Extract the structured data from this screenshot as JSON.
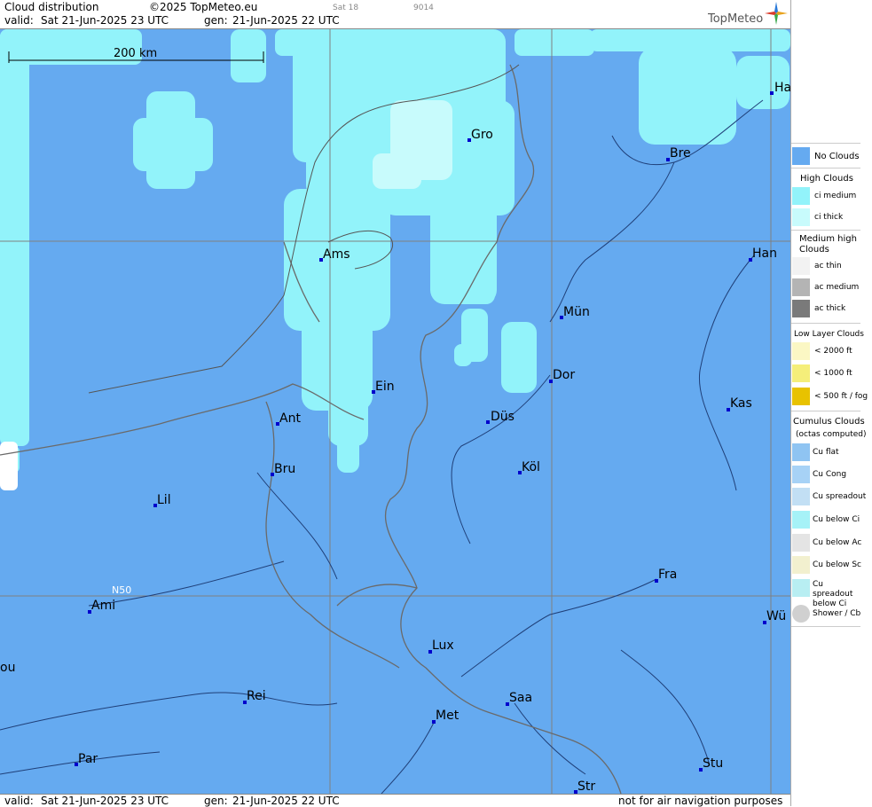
{
  "header": {
    "title": "Cloud distribution",
    "copyright": "©2025 TopMeteo.eu",
    "valid_label": "valid:",
    "valid_value": "Sat  21-Jun-2025  23 UTC",
    "gen_label": "gen:",
    "gen_value": "21-Jun-2025 22 UTC",
    "sat_text": "Sat 18",
    "code_text": "9014",
    "brand": "TopMeteo"
  },
  "footer": {
    "valid_label": "valid:",
    "valid_value": "Sat  21-Jun-2025  23 UTC",
    "gen_label": "gen:",
    "gen_value": "21-Jun-2025 22 UTC",
    "disclaimer": "not for air navigation purposes"
  },
  "map": {
    "scale_label": "200 km",
    "lat_label": "N50",
    "colors": {
      "no_clouds": "#65aaf0",
      "ci_medium": "#92f3fa",
      "ci_thick": "#c8fbfc",
      "border": "#6a6a6a",
      "river": "#1f3f78",
      "grid": "#808080"
    },
    "cities": [
      {
        "name": "Ha"
      },
      {
        "name": "Gro"
      },
      {
        "name": "Bre"
      },
      {
        "name": "Ams"
      },
      {
        "name": "Han"
      },
      {
        "name": "Mün"
      },
      {
        "name": "Dor"
      },
      {
        "name": "Ein"
      },
      {
        "name": "Kas"
      },
      {
        "name": "Ant"
      },
      {
        "name": "Düs"
      },
      {
        "name": "Köl"
      },
      {
        "name": "Bru"
      },
      {
        "name": "Lil"
      },
      {
        "name": "Fra"
      },
      {
        "name": "Ami"
      },
      {
        "name": "Wü"
      },
      {
        "name": "Lux"
      },
      {
        "name": "ou"
      },
      {
        "name": "Rei"
      },
      {
        "name": "Saa"
      },
      {
        "name": "Met"
      },
      {
        "name": "Par"
      },
      {
        "name": "Stu"
      },
      {
        "name": "Str"
      }
    ]
  },
  "legend": {
    "no_clouds": "No Clouds",
    "high_clouds": "High Clouds",
    "ci_medium": "ci medium",
    "ci_thick": "ci thick",
    "medium_high_clouds": "Medium high Clouds",
    "ac_thin": "ac thin",
    "ac_medium": "ac medium",
    "ac_thick": "ac thick",
    "low_layer_clouds": "Low Layer Clouds",
    "low_2000": "< 2000 ft",
    "low_1000": "< 1000 ft",
    "low_500": "< 500 ft / fog",
    "cumulus_clouds": "Cumulus Clouds",
    "octas_note": "(octas computed)",
    "cu_flat": "Cu flat",
    "cu_cong": "Cu Cong",
    "cu_spreadout": "Cu spreadout",
    "cu_below_ci": "Cu below Ci",
    "cu_below_ac": "Cu below Ac",
    "cu_below_sc": "Cu below Sc",
    "cu_spreadout_below_ci": "Cu spreadout below Ci",
    "shower_cb": "Shower / Cb"
  }
}
